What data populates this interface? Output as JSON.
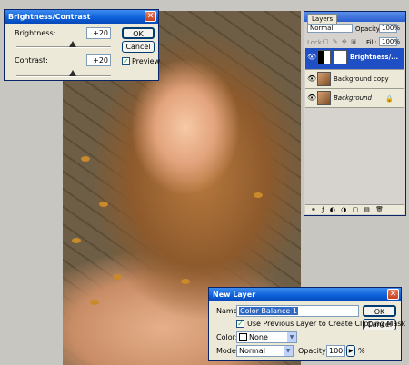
{
  "brightness_contrast": {
    "title": "Brightness/Contrast",
    "brightness_label": "Brightness:",
    "brightness_value": "+20",
    "contrast_label": "Contrast:",
    "contrast_value": "+20",
    "ok_label": "OK",
    "cancel_label": "Cancel",
    "preview_label": "Preview",
    "preview_checked": true,
    "brightness_slider_fraction": 0.6,
    "contrast_slider_fraction": 0.6
  },
  "layers_panel": {
    "tab_label": "Layers",
    "blend_mode": "Normal",
    "opacity_label": "Opacity:",
    "opacity_value": "100%",
    "lock_label": "Lock:",
    "fill_label": "Fill:",
    "fill_value": "100%",
    "layers": [
      {
        "name": "Brightness/...",
        "selected": true
      },
      {
        "name": "Background copy",
        "selected": false
      },
      {
        "name": "Background",
        "selected": false
      }
    ]
  },
  "new_layer": {
    "title": "New Layer",
    "name_label": "Name:",
    "name_value": "Color Balance 1",
    "ok_label": "OK",
    "cancel_label": "Cancel",
    "clipping_label": "Use Previous Layer to Create Clipping Mask",
    "clipping_checked": true,
    "color_label": "Color:",
    "color_value": "None",
    "mode_label": "Mode:",
    "mode_value": "Normal",
    "opacity_label": "Opacity:",
    "opacity_value": "100",
    "percent": "%"
  }
}
